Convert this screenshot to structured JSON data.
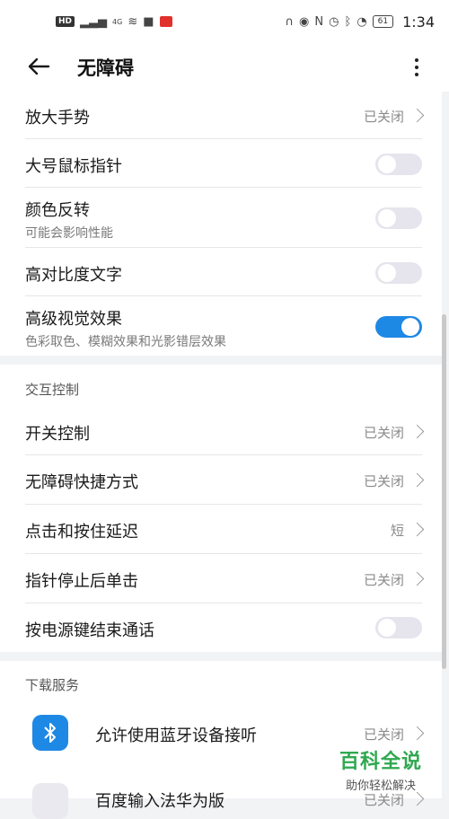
{
  "status_bar": {
    "hd": "HD",
    "net": "4G",
    "battery": "61",
    "time": "1:34"
  },
  "header": {
    "title": "无障碍"
  },
  "vision": {
    "items": [
      {
        "title": "放大手势",
        "value": "已关闭"
      },
      {
        "title": "大号鼠标指针",
        "toggle": false
      },
      {
        "title": "颜色反转",
        "subtitle": "可能会影响性能",
        "toggle": false
      },
      {
        "title": "高对比度文字",
        "toggle": false
      },
      {
        "title": "高级视觉效果",
        "subtitle": "色彩取色、模糊效果和光影错层效果",
        "toggle": true
      }
    ]
  },
  "interaction": {
    "section_title": "交互控制",
    "items": [
      {
        "title": "开关控制",
        "value": "已关闭"
      },
      {
        "title": "无障碍快捷方式",
        "value": "已关闭"
      },
      {
        "title": "点击和按住延迟",
        "value": "短"
      },
      {
        "title": "指针停止后单击",
        "value": "已关闭"
      },
      {
        "title": "按电源键结束通话",
        "toggle": false
      }
    ]
  },
  "download": {
    "section_title": "下载服务",
    "items": [
      {
        "title": "允许使用蓝牙设备接听",
        "value": "已关闭",
        "icon": "bluetooth-icon"
      },
      {
        "title": "百度输入法华为版",
        "value": "已关闭",
        "icon": "baidu-input-icon"
      }
    ]
  },
  "watermark": {
    "main": "百科全说",
    "sub": "助你轻松解决"
  },
  "colors": {
    "accent": "#1e88e5",
    "toggle_off": "#e6e4ec",
    "background": "#f1f3f5",
    "watermark": "#2fa84f"
  }
}
